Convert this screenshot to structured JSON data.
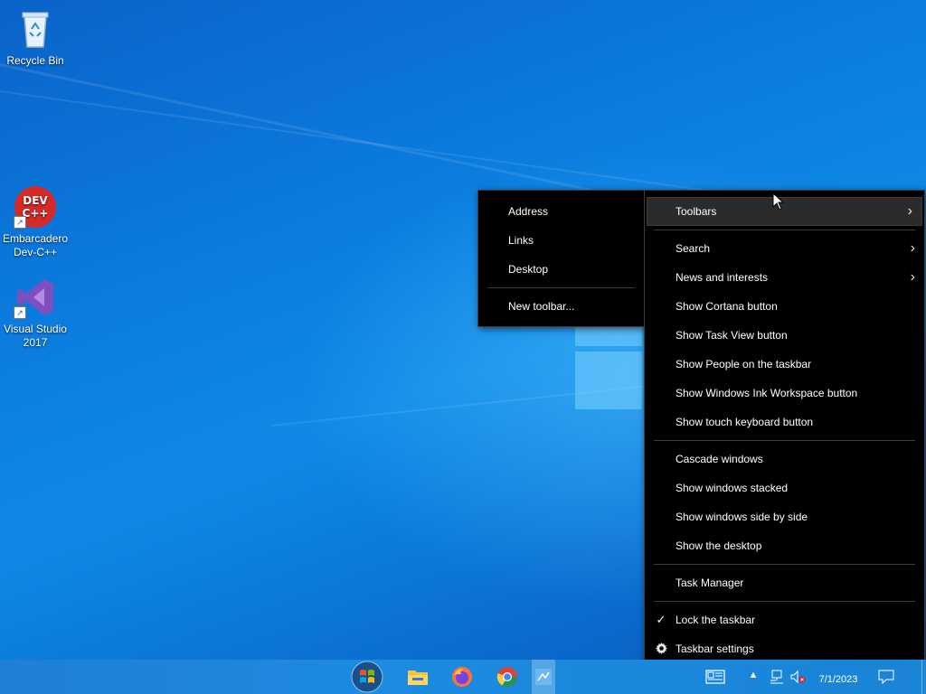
{
  "desktop": {
    "icons": [
      {
        "label": "Recycle Bin"
      },
      {
        "label": "Embarcadero Dev-C++",
        "badge": "DEV C++"
      },
      {
        "label": "Visual Studio 2017"
      }
    ]
  },
  "toolbars_submenu": {
    "items": [
      {
        "label": "Address"
      },
      {
        "label": "Links"
      },
      {
        "label": "Desktop"
      },
      {
        "label": "New toolbar..."
      }
    ]
  },
  "context_menu": {
    "items": [
      {
        "label": "Toolbars",
        "submenu": true,
        "hovered": true
      },
      {
        "label": "Search",
        "submenu": true
      },
      {
        "label": "News and interests",
        "submenu": true
      },
      {
        "label": "Show Cortana button"
      },
      {
        "label": "Show Task View button"
      },
      {
        "label": "Show People on the taskbar"
      },
      {
        "label": "Show Windows Ink Workspace button"
      },
      {
        "label": "Show touch keyboard button"
      },
      {
        "label": "Cascade windows"
      },
      {
        "label": "Show windows stacked"
      },
      {
        "label": "Show windows side by side"
      },
      {
        "label": "Show the desktop"
      },
      {
        "label": "Task Manager"
      },
      {
        "label": "Lock the taskbar",
        "checked": true
      },
      {
        "label": "Taskbar settings",
        "icon": "gear-icon"
      }
    ],
    "check_glyph": "✓",
    "chevron_glyph": "›"
  },
  "taskbar": {
    "apps": [
      {
        "name": "start-orb-icon"
      },
      {
        "name": "file-explorer-icon"
      },
      {
        "name": "firefox-icon"
      },
      {
        "name": "chrome-icon"
      },
      {
        "name": "active-window-icon",
        "active": true
      }
    ],
    "clock": {
      "time": "",
      "date": "7/1/2023"
    }
  },
  "colors": {
    "menu_bg": "#000000",
    "menu_hover": "#2b2b2b",
    "taskbar": "#1c8be0"
  }
}
